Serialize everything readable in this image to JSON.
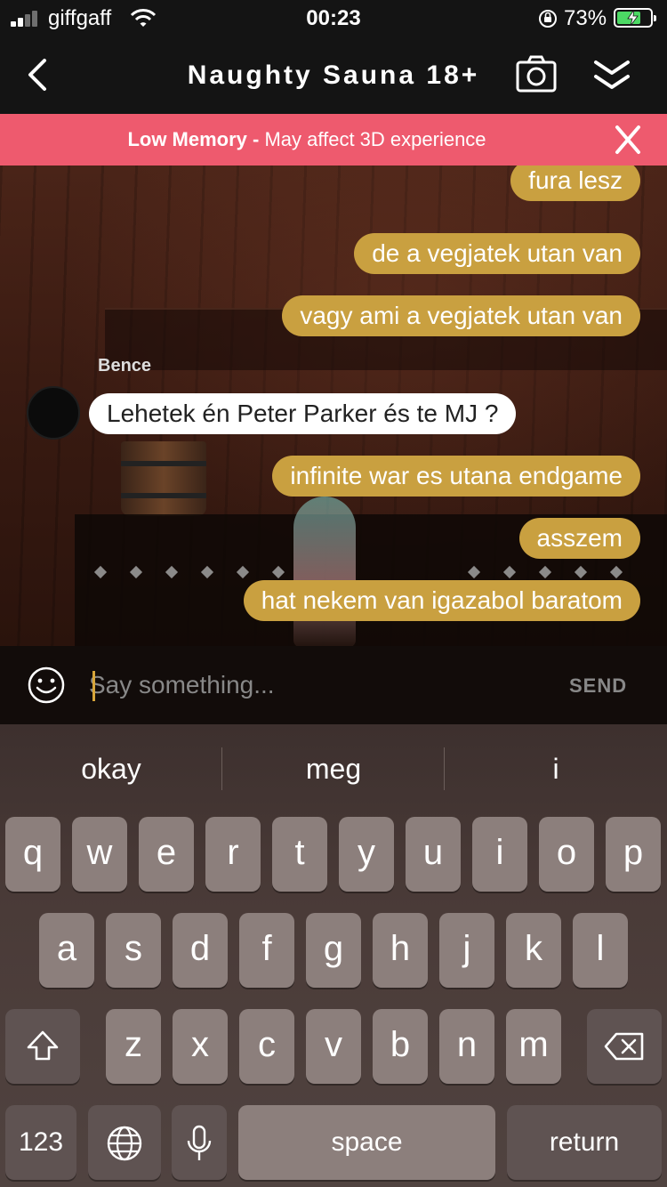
{
  "status_bar": {
    "carrier": "giffgaff",
    "time": "00:23",
    "battery_percent": "73%",
    "battery_level": 0.73,
    "battery_color": "#4cd964",
    "icons": [
      "signal-icon",
      "wifi-icon",
      "orientation-lock-icon",
      "battery-charging-icon"
    ]
  },
  "nav": {
    "title": "Naughty Sauna 18+",
    "icons": [
      "back-chevron-icon",
      "camera-icon",
      "double-chevron-down-icon"
    ]
  },
  "banner": {
    "title": "Low Memory -",
    "message": "May affect 3D experience",
    "color": "#ee5a6e",
    "icon": "close-icon"
  },
  "chat": {
    "partial_text": "fura lesz",
    "messages": [
      {
        "text": "de a vegjatek utan van",
        "mine": true
      },
      {
        "text": "vagy ami a vegjatek utan van",
        "mine": true
      },
      {
        "text": "Lehetek én Peter Parker és te MJ ?",
        "mine": false,
        "sender": "Bence"
      },
      {
        "text": "infinite war es utana endgame",
        "mine": true
      },
      {
        "text": "asszem",
        "mine": true
      },
      {
        "text": "hat nekem van igazabol baratom",
        "mine": true
      }
    ],
    "own_bubble_color": "#c9a040",
    "other_bubble_color": "#ffffff"
  },
  "composer": {
    "placeholder": "Say something...",
    "value": "",
    "send_label": "SEND",
    "icon": "smiley-icon"
  },
  "keyboard": {
    "suggestions": [
      "okay",
      "meg",
      "i"
    ],
    "row1": [
      "q",
      "w",
      "e",
      "r",
      "t",
      "y",
      "u",
      "i",
      "o",
      "p"
    ],
    "row2": [
      "a",
      "s",
      "d",
      "f",
      "g",
      "h",
      "j",
      "k",
      "l"
    ],
    "row3": [
      "z",
      "x",
      "c",
      "v",
      "b",
      "n",
      "m"
    ],
    "numbers_label": "123",
    "space_label": "space",
    "return_label": "return",
    "icons": [
      "shift-icon",
      "backspace-icon",
      "globe-icon",
      "microphone-icon"
    ]
  }
}
